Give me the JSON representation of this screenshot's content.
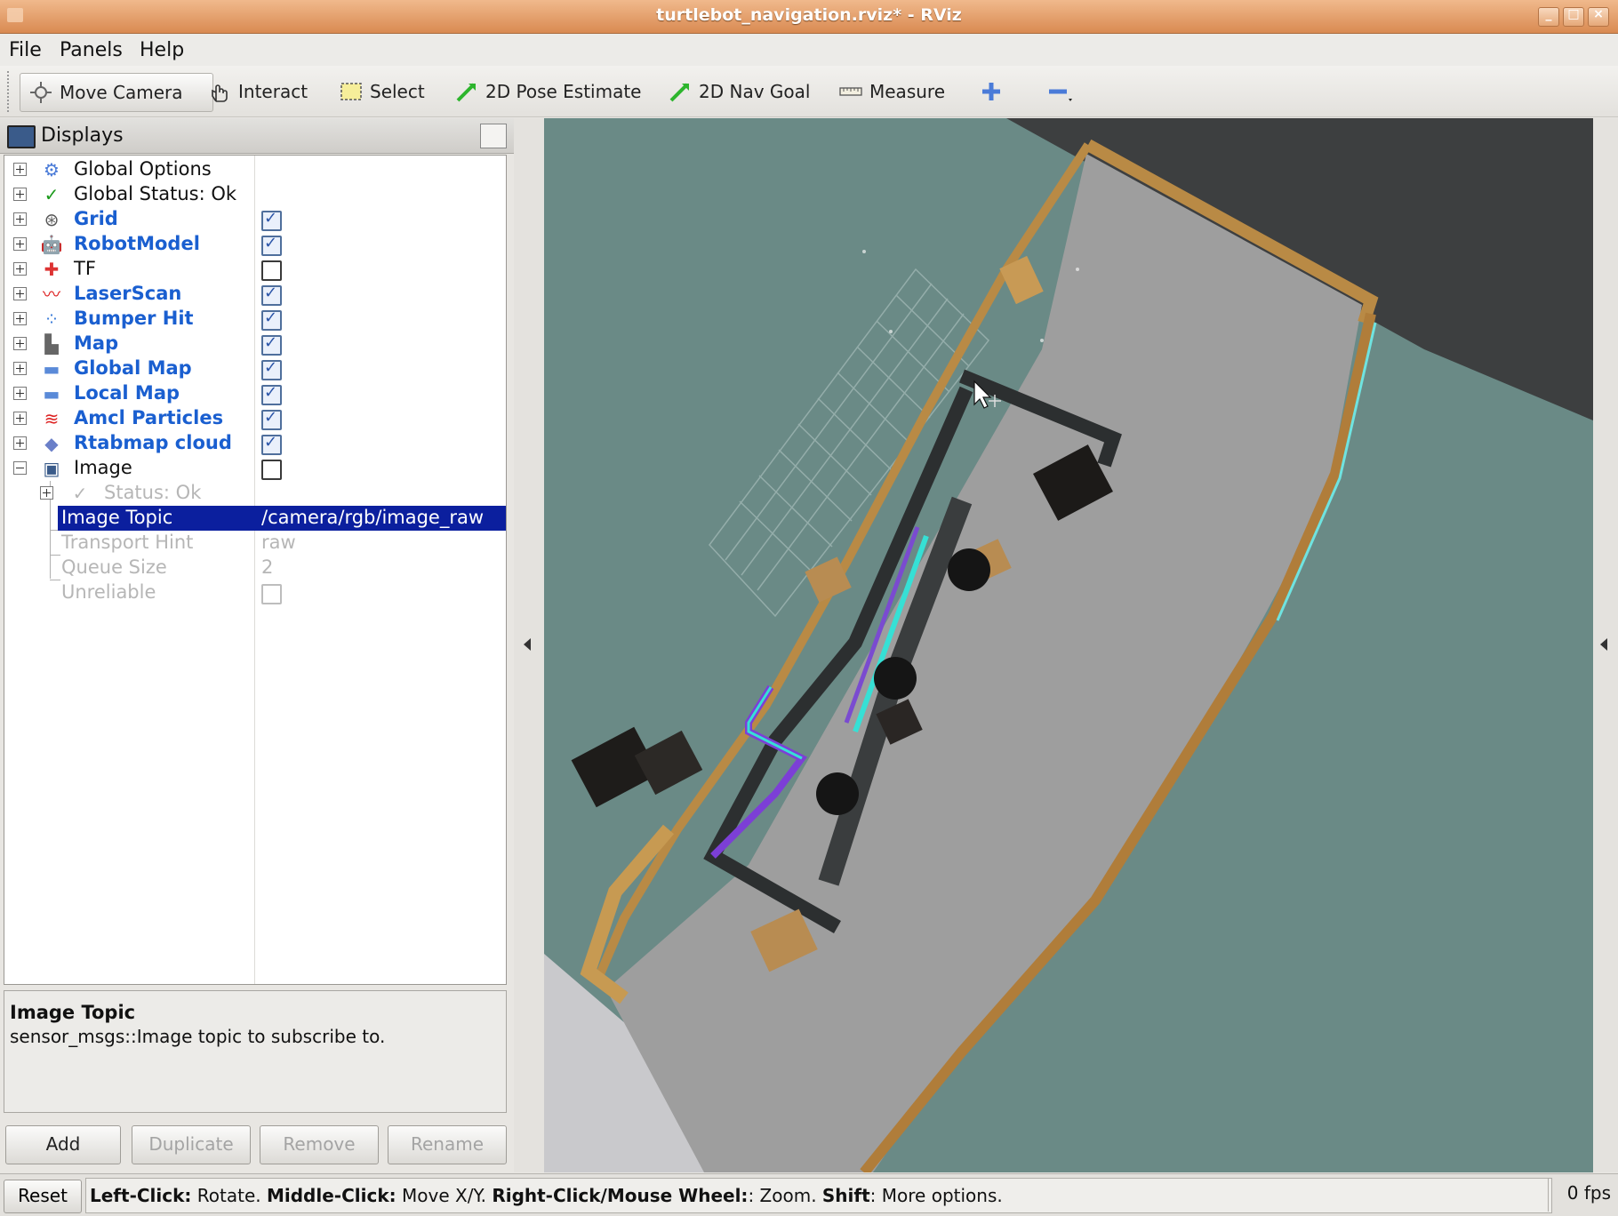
{
  "window": {
    "title": "turtlebot_navigation.rviz* - RViz"
  },
  "menu": [
    "File",
    "Panels",
    "Help"
  ],
  "toolbar": {
    "move_camera": "Move Camera",
    "interact": "Interact",
    "select": "Select",
    "pose_estimate": "2D Pose Estimate",
    "nav_goal": "2D Nav Goal",
    "measure": "Measure"
  },
  "displays": {
    "title": "Displays",
    "items": [
      {
        "name": "Global Options"
      },
      {
        "name": "Global Status: Ok"
      },
      {
        "name": "Grid",
        "checked": true
      },
      {
        "name": "RobotModel",
        "checked": true
      },
      {
        "name": "TF",
        "checked": false
      },
      {
        "name": "LaserScan",
        "checked": true
      },
      {
        "name": "Bumper Hit",
        "checked": true
      },
      {
        "name": "Map",
        "checked": true
      },
      {
        "name": "Global Map",
        "checked": true
      },
      {
        "name": "Local Map",
        "checked": true
      },
      {
        "name": "Amcl Particles",
        "checked": true
      },
      {
        "name": "Rtabmap cloud",
        "checked": true
      },
      {
        "name": "Image",
        "checked": false
      },
      {
        "name": "Status: Ok"
      },
      {
        "name": "Image Topic",
        "value": "/camera/rgb/image_raw"
      },
      {
        "name": "Transport Hint",
        "value": "raw"
      },
      {
        "name": "Queue Size",
        "value": "2"
      },
      {
        "name": "Unreliable",
        "checked": false
      }
    ]
  },
  "description": {
    "title": "Image Topic",
    "text": "sensor_msgs::Image topic to subscribe to."
  },
  "panel_buttons": {
    "add": "Add",
    "duplicate": "Duplicate",
    "remove": "Remove",
    "rename": "Rename"
  },
  "status": {
    "reset": "Reset",
    "k1": "Left-Click:",
    "v1": " Rotate. ",
    "k2": "Middle-Click:",
    "v2": " Move X/Y. ",
    "k3": "Right-Click/Mouse Wheel:",
    "v3": ": Zoom. ",
    "k4": "Shift",
    "v4": ": More options.",
    "fps": "0 fps"
  },
  "colors": {
    "titlebar": "#d98a52",
    "selection": "#0b1f9e",
    "display_name_blue": "#1a5fd0",
    "viewport_bg": "#6a8a86",
    "floor": "#9e9e9e",
    "wall": "#b98a45"
  }
}
